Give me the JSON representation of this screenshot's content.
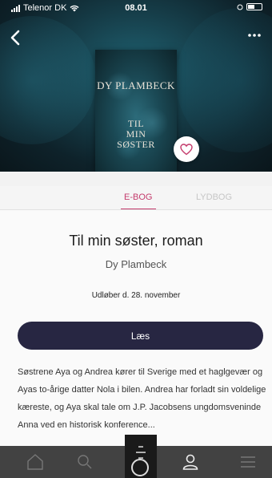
{
  "status_bar": {
    "carrier": "Telenor DK",
    "time": "08.01"
  },
  "book": {
    "cover": {
      "author_text": "DY PLAMBECK",
      "title_lines": [
        "TIL",
        "MIN",
        "SØSTER"
      ]
    },
    "title": "Til min søster, roman",
    "author": "Dy Plambeck",
    "expiry": "Udløber d. 28. november",
    "read_label": "Læs",
    "description": "Søstrene Aya og Andrea kører til Sverige med et haglgevær og Ayas to-årige datter Nola i bilen. Andrea har forladt sin voldelige kæreste, og Aya skal tale om J.P. Jacobsens ungdomsveninde Anna ved en historisk konference..."
  },
  "tabs": [
    {
      "label": "E-BOG",
      "active": true
    },
    {
      "label": "LYDBOG",
      "active": false
    }
  ],
  "colors": {
    "accent": "#c43b6c",
    "button": "#272642",
    "tabbar": "#323232"
  },
  "icons": {
    "back": "chevron-left-icon",
    "more": "more-dots-icon",
    "favorite": "heart-icon",
    "tabbar": [
      "home-icon",
      "search-icon",
      "center-logo-icon",
      "profile-icon",
      "menu-icon"
    ]
  }
}
